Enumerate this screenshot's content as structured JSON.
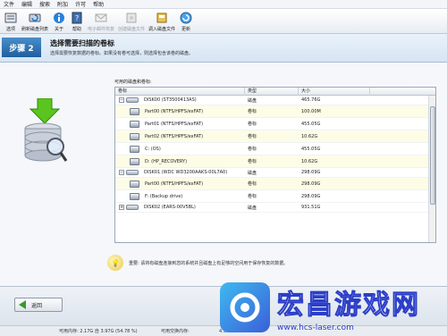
{
  "menu": [
    "文件",
    "编辑",
    "搜索",
    "附加",
    "许可",
    "帮助"
  ],
  "toolbar": {
    "items": [
      {
        "label": "选项",
        "icon": "options-icon",
        "disabled": false
      },
      {
        "label": "刷新磁盘列表",
        "icon": "refresh-icon",
        "disabled": false
      },
      {
        "label": "关于",
        "icon": "info-icon",
        "disabled": false
      },
      {
        "label": "帮助",
        "icon": "help-icon",
        "disabled": false
      },
      {
        "label": "电子邮件恢复",
        "icon": "email-icon",
        "disabled": true
      },
      {
        "label": "创建磁盘文件",
        "icon": "disk-image-icon",
        "disabled": true
      },
      {
        "label": "调入磁盘文件",
        "icon": "load-disk-icon",
        "disabled": false
      },
      {
        "label": "更新",
        "icon": "update-icon",
        "disabled": false
      }
    ]
  },
  "step": {
    "badge": "步骤 2",
    "title": "选择需要扫描的卷标",
    "subtitle": "选择需要恢复数据的卷标。如果没有卷可选择，则选择包含该卷的磁盘。"
  },
  "tree": {
    "label": "可用的磁盘和卷标:",
    "headers": {
      "name": "卷标",
      "type": "类型",
      "size": "大小"
    },
    "rows": [
      {
        "kind": "disk",
        "expander": "⊟",
        "name": "DISK00 (ST3500413AS)",
        "type": "磁盘",
        "size": "465.76G"
      },
      {
        "kind": "part",
        "name": "Part00 (NTFS/HPFS/exFAT)",
        "type": "卷标",
        "size": "100.00M"
      },
      {
        "kind": "part",
        "name": "Part01 (NTFS/HPFS/exFAT)",
        "type": "卷标",
        "size": "455.05G"
      },
      {
        "kind": "part",
        "name": "Part02 (NTFS/HPFS/exFAT)",
        "type": "卷标",
        "size": "10.62G"
      },
      {
        "kind": "part",
        "name": "C: (OS)",
        "type": "卷标",
        "size": "455.05G"
      },
      {
        "kind": "part",
        "name": "D: (HP_RECOVERY)",
        "type": "卷标",
        "size": "10.62G"
      },
      {
        "kind": "disk",
        "expander": "⊟",
        "name": "DISK01 (WDC WD3200AAKS-00L7A0)",
        "type": "磁盘",
        "size": "298.09G"
      },
      {
        "kind": "part",
        "name": "Part00 (NTFS/HPFS/exFAT)",
        "type": "卷标",
        "size": "298.09G"
      },
      {
        "kind": "part",
        "name": "F: (Backup drive)",
        "type": "卷标",
        "size": "298.09G"
      },
      {
        "kind": "disk",
        "expander": "⊞",
        "name": "DISK02 (EARS-00V5BL)",
        "type": "磁盘",
        "size": "931.51G"
      }
    ]
  },
  "tip": {
    "text": "重要: 请将有磁盘连接到您的系统并且磁盘上有足够的空间用于保存恢复的数据。"
  },
  "footer": {
    "back_label": "返回"
  },
  "status": {
    "mem": "可用内存: 2.17G 自 3.97G (54.78 %)",
    "swap_label": "可用交换内存:",
    "swap_value": "4.37G"
  },
  "watermark": {
    "title": "宏昌游戏网",
    "url": "www.hcs-laser.com"
  },
  "colors": {
    "accent": "#1f5e9e",
    "tree_alt_row": "#fdfce6",
    "back_arrow": "#3a9a2a"
  }
}
